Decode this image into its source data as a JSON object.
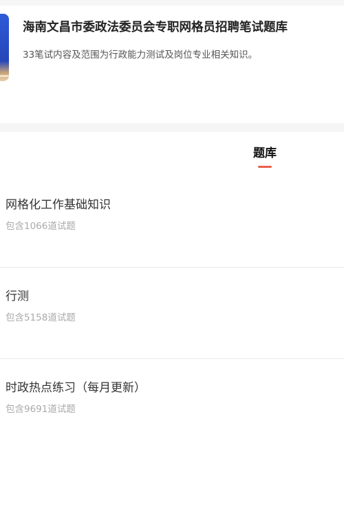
{
  "header": {
    "title": "海南文昌市委政法委员会专职网格员招聘笔试题库",
    "description": "33笔试内容及范围为行政能力测试及岗位专业相关知识。"
  },
  "tabs": [
    {
      "label": "题库",
      "active": true
    }
  ],
  "colors": {
    "accent": "#e8604a",
    "cover_blue": "#2f5ad8"
  },
  "question_banks": [
    {
      "name": "网格化工作基础知识",
      "count_text": "包含1066道试题"
    },
    {
      "name": "行测",
      "count_text": "包含5158道试题"
    },
    {
      "name": "时政热点练习（每月更新）",
      "count_text": "包含9691道试题"
    }
  ]
}
